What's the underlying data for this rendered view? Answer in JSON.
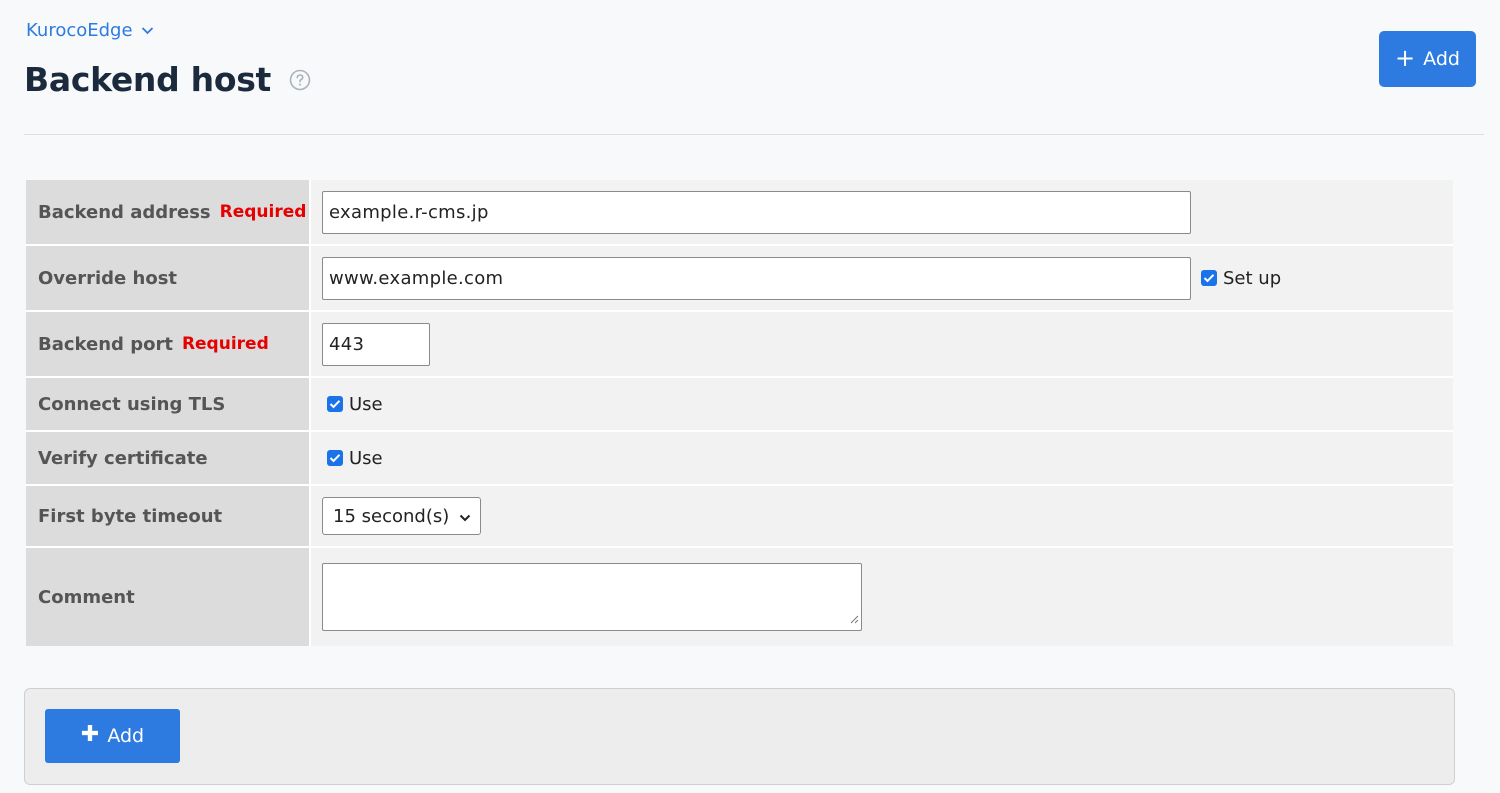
{
  "header": {
    "app_name": "KurocoEdge",
    "title": "Backend host",
    "add_label": "Add"
  },
  "form": {
    "required_label": "Required",
    "backend_address": {
      "label": "Backend address",
      "value": "example.r-cms.jp"
    },
    "override_host": {
      "label": "Override host",
      "value": "www.example.com",
      "checkbox_label": "Set up",
      "checked": true
    },
    "backend_port": {
      "label": "Backend port",
      "value": "443"
    },
    "connect_tls": {
      "label": "Connect using TLS",
      "checkbox_label": "Use",
      "checked": true
    },
    "verify_cert": {
      "label": "Verify certificate",
      "checkbox_label": "Use",
      "checked": true
    },
    "first_byte_timeout": {
      "label": "First byte timeout",
      "selected": "15 second(s)"
    },
    "comment": {
      "label": "Comment",
      "value": ""
    }
  },
  "footer": {
    "add_label": "Add"
  },
  "colors": {
    "accent": "#2d7be0",
    "required": "#e60000"
  }
}
